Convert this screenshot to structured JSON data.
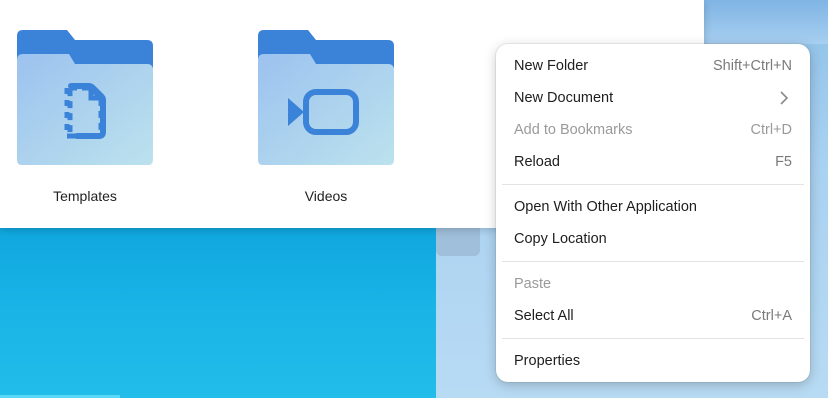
{
  "file_manager": {
    "folders": [
      {
        "label": "Templates",
        "icon": "template-file-icon"
      },
      {
        "label": "Videos",
        "icon": "video-camera-icon"
      }
    ]
  },
  "context_menu": {
    "items": [
      {
        "label": "New Folder",
        "shortcut": "Shift+Ctrl+N",
        "enabled": true
      },
      {
        "label": "New Document",
        "shortcut": "",
        "submenu": true,
        "enabled": true
      },
      {
        "label": "Add to Bookmarks",
        "shortcut": "Ctrl+D",
        "enabled": false
      },
      {
        "label": "Reload",
        "shortcut": "F5",
        "enabled": true
      },
      {
        "label": "Open With Other Application",
        "shortcut": "",
        "enabled": true
      },
      {
        "label": "Copy Location",
        "shortcut": "",
        "enabled": true
      },
      {
        "label": "Paste",
        "shortcut": "",
        "enabled": false
      },
      {
        "label": "Select All",
        "shortcut": "Ctrl+A",
        "enabled": true
      },
      {
        "label": "Properties",
        "shortcut": "",
        "enabled": true
      }
    ]
  },
  "colors": {
    "folder_back": "#3b82d9",
    "folder_front_top": "#9fc5ef",
    "folder_front_bottom": "#b9dff0",
    "folder_glyph": "#3b82d9"
  }
}
